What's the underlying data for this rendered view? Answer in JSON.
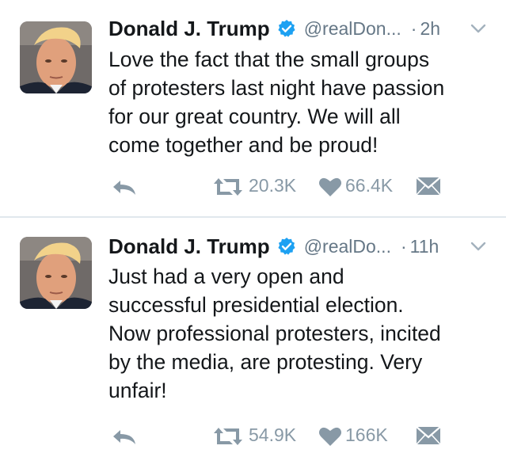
{
  "colors": {
    "text": "#14171a",
    "secondary": "#657786",
    "icon": "#8899a6",
    "verified": "#1da1f2",
    "divider": "#e1e8ed"
  },
  "tweets": [
    {
      "name": "Donald J. Trump",
      "handle": "@realDon...",
      "separator": "·",
      "time": "2h",
      "text": "Love the fact that the small groups\nof protesters last night have passion\nfor our great country. We will all\ncome together and be proud!",
      "retweets": "20.3K",
      "likes": "66.4K",
      "icons": [
        "verified-badge-icon",
        "chevron-down-icon",
        "reply-icon",
        "retweet-icon",
        "heart-icon",
        "direct-message-icon"
      ]
    },
    {
      "name": "Donald J. Trump",
      "handle": "@realDo...",
      "separator": "·",
      "time": "11h",
      "text": "Just had a very open and\nsuccessful presidential election.\nNow professional protesters, incited\nby the media, are protesting. Very\nunfair!",
      "retweets": "54.9K",
      "likes": "166K",
      "icons": [
        "verified-badge-icon",
        "chevron-down-icon",
        "reply-icon",
        "retweet-icon",
        "heart-icon",
        "direct-message-icon"
      ]
    }
  ]
}
